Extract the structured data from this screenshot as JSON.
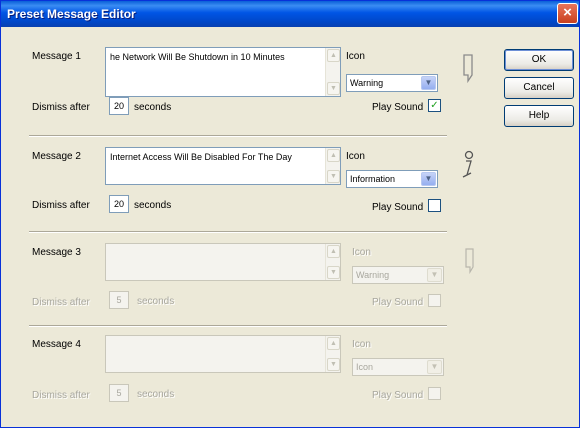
{
  "window": {
    "title": "Preset Message Editor",
    "close_glyph": "×"
  },
  "labels": {
    "dismiss_after": "Dismiss after",
    "seconds": "seconds",
    "icon": "Icon",
    "play_sound": "Play Sound"
  },
  "messages": [
    {
      "label": "Message 1",
      "text": "he Network Will Be Shutdown in 10 Minutes",
      "dismiss_seconds": "20",
      "icon_value": "Warning",
      "play_sound": true,
      "enabled": true,
      "preview_icon": "warning-icon"
    },
    {
      "label": "Message 2",
      "text": "Internet Access Will Be Disabled For The Day",
      "dismiss_seconds": "20",
      "icon_value": "Information",
      "play_sound": false,
      "enabled": true,
      "preview_icon": "information-icon"
    },
    {
      "label": "Message 3",
      "text": "",
      "dismiss_seconds": "5",
      "icon_value": "Warning",
      "play_sound": false,
      "enabled": false,
      "preview_icon": "warning-icon"
    },
    {
      "label": "Message 4",
      "text": "",
      "dismiss_seconds": "5",
      "icon_value": "Icon",
      "play_sound": false,
      "enabled": false,
      "preview_icon": "none"
    }
  ],
  "buttons": {
    "ok": "OK",
    "cancel": "Cancel",
    "help": "Help"
  },
  "colors": {
    "titlebar": "#0055e5",
    "dialog_bg": "#ece9d8",
    "disabled_text": "#a8a79e",
    "checkmark": "#21a121"
  }
}
